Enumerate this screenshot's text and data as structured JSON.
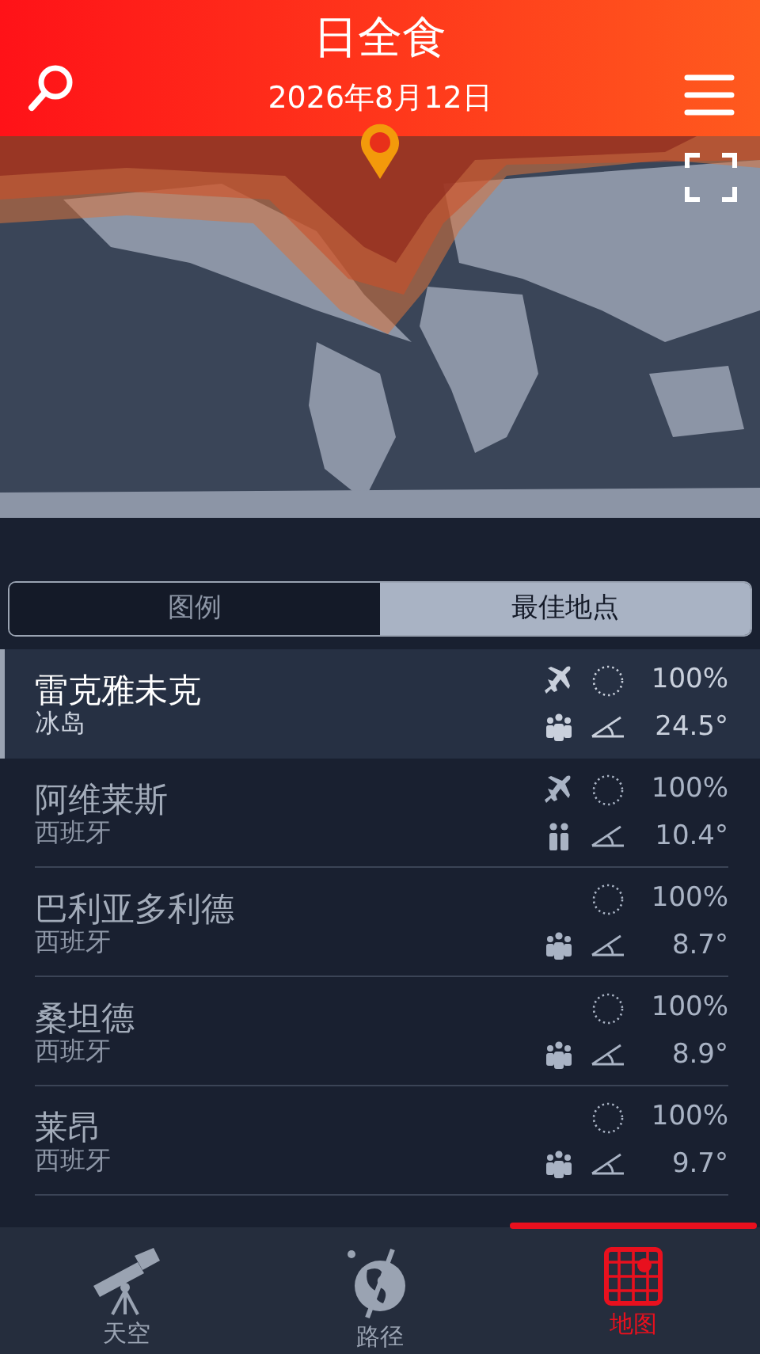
{
  "header": {
    "title": "日全食",
    "date": "2026年8月12日"
  },
  "segments": [
    {
      "label": "图例",
      "selected": false
    },
    {
      "label": "最佳地点",
      "selected": true
    }
  ],
  "locations": [
    {
      "name": "雷克雅未克",
      "country": "冰岛",
      "selected": true,
      "airport": true,
      "large_crowd": true,
      "coverage": "100%",
      "altitude": "24.5°"
    },
    {
      "name": "阿维莱斯",
      "country": "西班牙",
      "selected": false,
      "airport": true,
      "large_crowd": false,
      "coverage": "100%",
      "altitude": "10.4°"
    },
    {
      "name": "巴利亚多利德",
      "country": "西班牙",
      "selected": false,
      "airport": false,
      "large_crowd": true,
      "coverage": "100%",
      "altitude": "8.7°"
    },
    {
      "name": "桑坦德",
      "country": "西班牙",
      "selected": false,
      "airport": false,
      "large_crowd": true,
      "coverage": "100%",
      "altitude": "8.9°"
    },
    {
      "name": "莱昂",
      "country": "西班牙",
      "selected": false,
      "airport": false,
      "large_crowd": true,
      "coverage": "100%",
      "altitude": "9.7°"
    }
  ],
  "bottom_nav": [
    {
      "label": "天空",
      "kind": "telescope",
      "selected": false
    },
    {
      "label": "路径",
      "kind": "globe",
      "selected": false
    },
    {
      "label": "地图",
      "kind": "map",
      "selected": true
    }
  ]
}
